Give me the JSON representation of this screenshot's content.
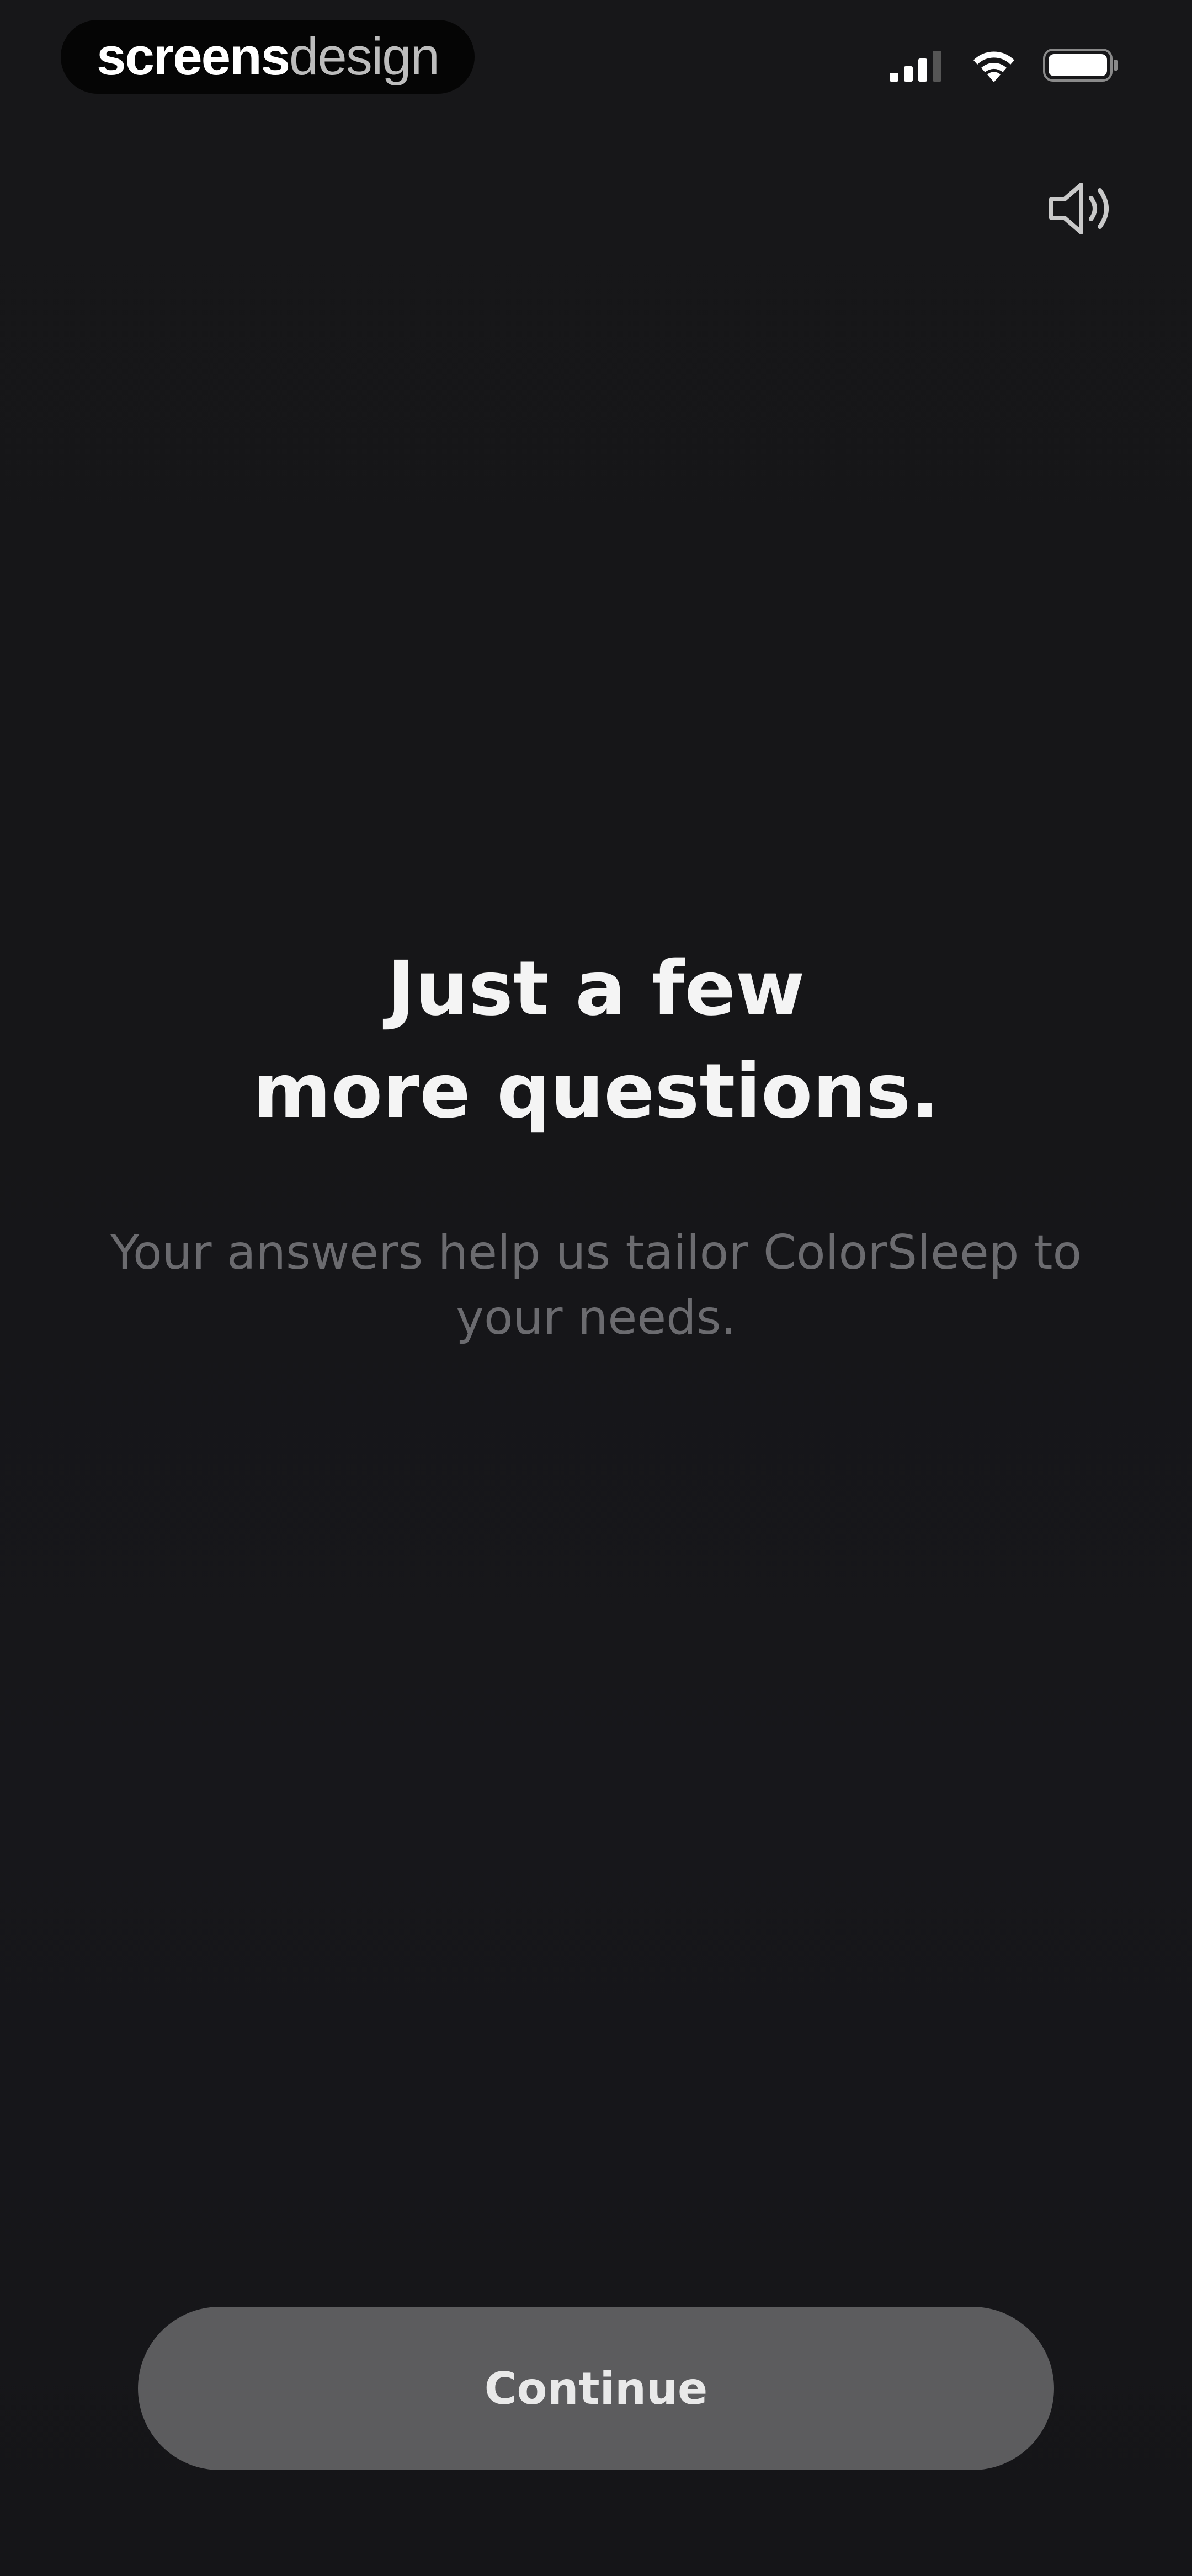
{
  "status_bar": {
    "badge_bold": "screens",
    "badge_light": "design",
    "icons": [
      "cellular-signal-icon",
      "wifi-icon",
      "battery-icon"
    ]
  },
  "header": {
    "sound_icon": "speaker-icon"
  },
  "main": {
    "headline_line1": "Just a few",
    "headline_line2": "more questions.",
    "subtitle_line1": "Your answers help us tailor ColorSleep to",
    "subtitle_line2": "your needs."
  },
  "footer": {
    "continue_label": "Continue"
  },
  "colors": {
    "background": "#16161a",
    "headline": "#f4f4f4",
    "subtitle": "#6b6b6f",
    "button_bg": "#5c5c5e",
    "button_text": "#e9e9e9"
  }
}
